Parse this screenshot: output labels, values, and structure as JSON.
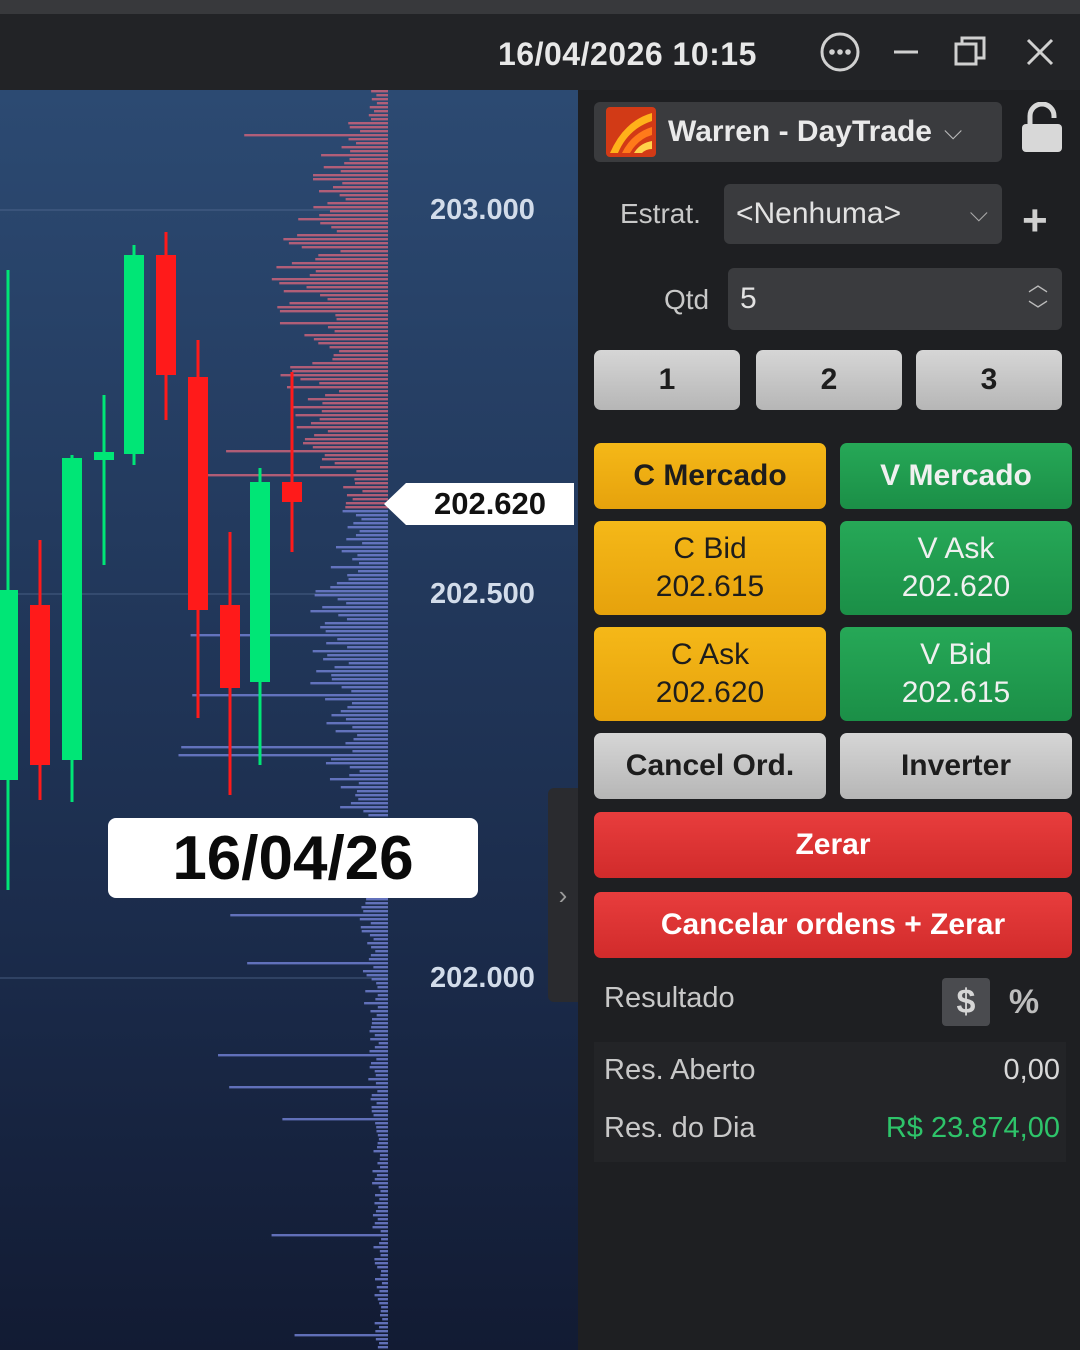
{
  "window": {
    "datetime": "16/04/2026 10:15",
    "icons": [
      "more-icon",
      "minimize-icon",
      "restore-icon",
      "close-icon"
    ]
  },
  "chart": {
    "price_labels": [
      "203.000",
      "202.500",
      "202.000"
    ],
    "last_price": "202.620",
    "date_overlay": "16/04/26",
    "colors": {
      "up": "#00e676",
      "down": "#ff1a1a",
      "sell_volume": "#c9637a",
      "buy_volume": "#6f7ecf"
    }
  },
  "panel": {
    "account": {
      "name": "Warren - DayTrade"
    },
    "strategy": {
      "label": "Estrat.",
      "value": "<Nenhuma>"
    },
    "quantity": {
      "label": "Qtd",
      "value": "5"
    },
    "presets": [
      "1",
      "2",
      "3"
    ],
    "buttons": {
      "buy_market": "C Mercado",
      "sell_market": "V Mercado",
      "buy_bid_label": "C Bid",
      "buy_bid_price": "202.615",
      "sell_ask_label": "V Ask",
      "sell_ask_price": "202.620",
      "buy_ask_label": "C Ask",
      "buy_ask_price": "202.620",
      "sell_bid_label": "V Bid",
      "sell_bid_price": "202.615",
      "cancel_orders": "Cancel Ord.",
      "invert": "Inverter",
      "zero": "Zerar",
      "cancel_and_zero": "Cancelar ordens + Zerar"
    },
    "result": {
      "title": "Resultado",
      "currency_toggle": "$",
      "percent_toggle": "%",
      "open_label": "Res. Aberto",
      "open_value": "0,00",
      "day_label": "Res. do Dia",
      "day_value": "R$ 23.874,00",
      "day_value_color": "#2ec46a"
    }
  }
}
